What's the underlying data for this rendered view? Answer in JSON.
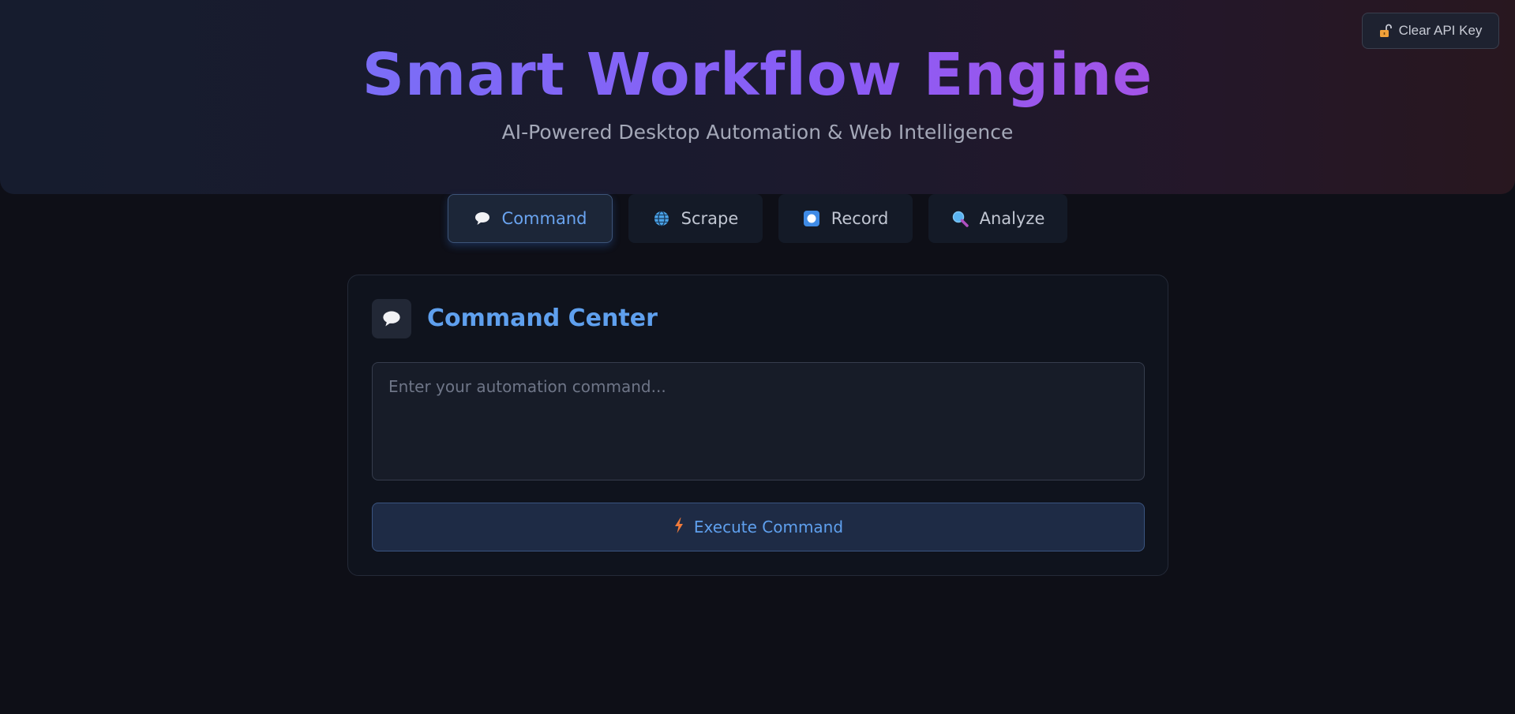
{
  "header": {
    "title": "Smart Workflow Engine",
    "subtitle": "AI-Powered Desktop Automation & Web Intelligence",
    "clear_key_label": "Clear API Key",
    "clear_key_icon": "unlocked-padlock-icon"
  },
  "tabs": [
    {
      "label": "Command",
      "icon": "speech-bubble-icon",
      "active": true
    },
    {
      "label": "Scrape",
      "icon": "globe-icon",
      "active": false
    },
    {
      "label": "Record",
      "icon": "record-icon",
      "active": false
    },
    {
      "label": "Analyze",
      "icon": "magnifier-icon",
      "active": false
    }
  ],
  "card": {
    "title": "Command Center",
    "icon": "speech-bubble-icon",
    "input_placeholder": "Enter your automation command...",
    "input_value": "",
    "execute_label": "Execute Command",
    "execute_icon": "lightning-icon"
  },
  "colors": {
    "accent": "#5fa0ee",
    "title_gradient_start": "#6f7bf7",
    "title_gradient_end": "#c04bd6",
    "background": "#0e0f17"
  }
}
